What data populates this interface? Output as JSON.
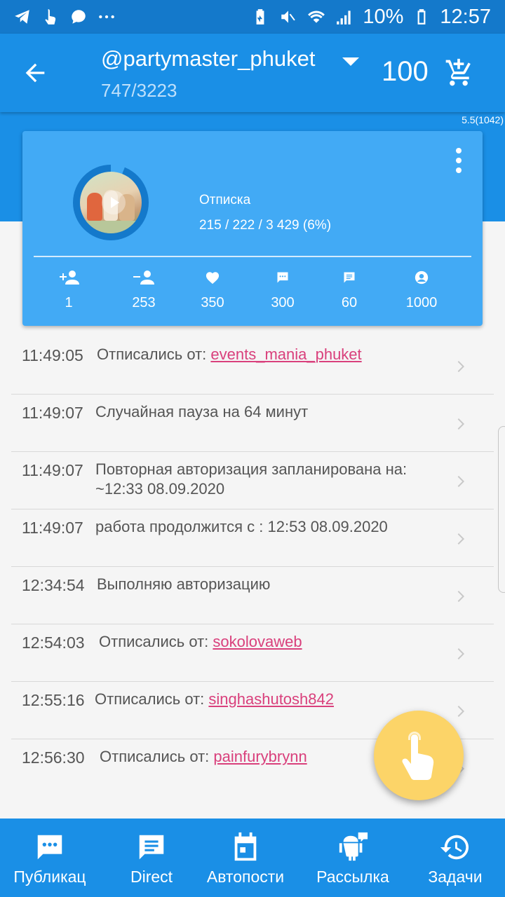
{
  "status_bar": {
    "battery": "10%",
    "time": "12:57"
  },
  "header": {
    "account": "@partymaster_phuket",
    "progress": "747/3223",
    "credits": "100",
    "version": "5.5(1042)"
  },
  "card": {
    "task": "Отписка",
    "stats": "215 / 222 / 3 429 (6%)",
    "ring_progress_percent": 6,
    "counters": [
      {
        "icon": "add-user-icon",
        "value": "1"
      },
      {
        "icon": "remove-user-icon",
        "value": "253"
      },
      {
        "icon": "heart-icon",
        "value": "350"
      },
      {
        "icon": "comment-icon",
        "value": "300"
      },
      {
        "icon": "message-icon",
        "value": "60"
      },
      {
        "icon": "profile-view-icon",
        "value": "1000"
      }
    ]
  },
  "log": [
    {
      "time": "11:49:05",
      "text": "Отписались от: ",
      "link": "events_mania_phuket"
    },
    {
      "time": "11:49:07",
      "text": "Случайная пауза на 64 минут",
      "link": ""
    },
    {
      "time": "11:49:07",
      "text": "Повторная авторизация запланирована на: ~12:33 08.09.2020",
      "link": ""
    },
    {
      "time": "11:49:07",
      "text": "работа продолжится с : 12:53 08.09.2020",
      "link": ""
    },
    {
      "time": "12:34:54",
      "text": "Выполняю авторизацию",
      "link": ""
    },
    {
      "time": "12:54:03",
      "text": "Отписались от: ",
      "link": "sokolovaweb"
    },
    {
      "time": "12:55:16",
      "text": "Отписались от: ",
      "link": "singhashutosh842"
    },
    {
      "time": "12:56:30",
      "text": "Отписались от: ",
      "link": "painfurybrynn"
    }
  ],
  "bottom_nav": [
    {
      "label": "Публикац",
      "icon": "publication-icon"
    },
    {
      "label": "Direct",
      "icon": "direct-icon"
    },
    {
      "label": "Автопости",
      "icon": "calendar-icon"
    },
    {
      "label": "Рассылка",
      "icon": "android-broadcast-icon"
    },
    {
      "label": "Задачи",
      "icon": "history-icon"
    }
  ],
  "colors": {
    "primary": "#1a8fe6",
    "status_bar": "#1479cb",
    "card": "#42aaf5",
    "link": "#d9407c",
    "fab": "#fcd468"
  }
}
